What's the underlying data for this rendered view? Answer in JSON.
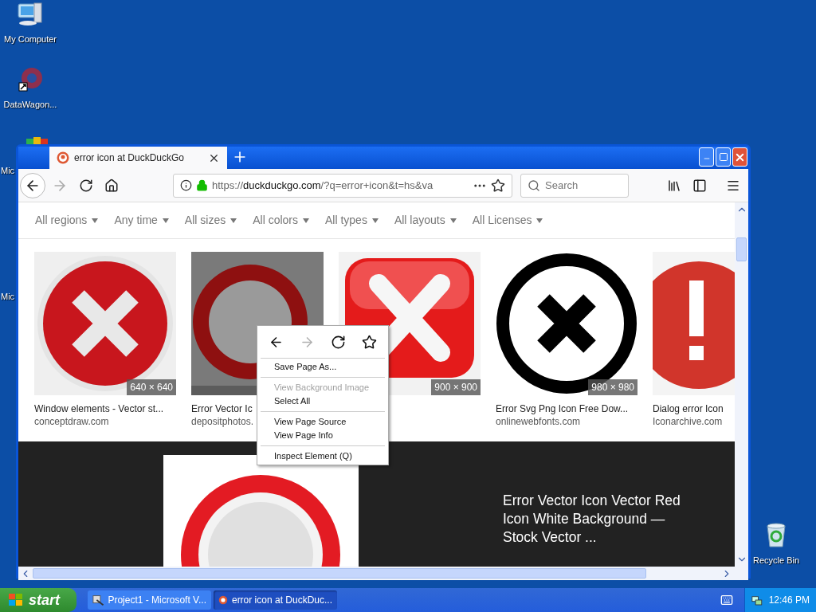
{
  "desktop": {
    "icons": [
      {
        "label": "My Computer",
        "kind": "computer"
      },
      {
        "label": "DataWagon...",
        "kind": "shortcut"
      },
      {
        "label": "Mic",
        "kind": "app"
      },
      {
        "label": "Mic",
        "kind": "hidden"
      },
      {
        "label": "Recycle Bin",
        "kind": "recycle"
      }
    ]
  },
  "browser": {
    "tabs": [
      {
        "title": "error icon at DuckDuckGo",
        "selected": true
      }
    ],
    "address": {
      "url_start": "https://",
      "url_host": "duckduckgo.com",
      "url_rest": "/?q=error+icon&t=hs&va"
    },
    "search": {
      "placeholder": "Search"
    },
    "filters": [
      "All regions",
      "Any time",
      "All sizes",
      "All colors",
      "All types",
      "All layouts",
      "All Licenses"
    ],
    "results": [
      {
        "title": "Window elements - Vector st...",
        "source": "conceptdraw.com",
        "size": "640 × 640",
        "kind": "round-x"
      },
      {
        "title": "Error Vector Ic",
        "source": "depositphotos.",
        "kind": "ring"
      },
      {
        "size": "900 × 900",
        "kind": "square-x"
      },
      {
        "title": "Error Svg Png Icon Free Dow...",
        "source": "onlinewebfonts.com",
        "size": "980 × 980",
        "kind": "black-x"
      },
      {
        "title": "Dialog error Icon",
        "source": "Iconarchive.com",
        "kind": "exclaim"
      }
    ],
    "featured": {
      "title": "Error Vector Icon Vector Red Icon White Background — Stock Vector ..."
    },
    "context_menu": {
      "nav": [
        {
          "kind": "back",
          "disabled": false
        },
        {
          "kind": "forward",
          "disabled": true
        },
        {
          "kind": "reload",
          "disabled": false
        },
        {
          "kind": "bookmark",
          "disabled": false
        }
      ],
      "items": [
        {
          "kind": "item",
          "label": "Save Page As...",
          "disabled": false
        },
        {
          "kind": "separator"
        },
        {
          "kind": "item",
          "label": "View Background Image",
          "disabled": true
        },
        {
          "kind": "item",
          "label": "Select All",
          "disabled": false
        },
        {
          "kind": "separator"
        },
        {
          "kind": "item",
          "label": "View Page Source",
          "disabled": false
        },
        {
          "kind": "item",
          "label": "View Page Info",
          "disabled": false
        },
        {
          "kind": "separator"
        },
        {
          "kind": "item",
          "label": "Inspect Element (Q)",
          "disabled": false
        }
      ]
    }
  },
  "taskbar": {
    "start": "start",
    "tasks": [
      {
        "label": "Project1 - Microsoft V...",
        "selected": false,
        "kind": "vb"
      },
      {
        "label": "error icon at DuckDuc...",
        "selected": true,
        "kind": "browser"
      }
    ],
    "clock": "12:46 PM"
  }
}
